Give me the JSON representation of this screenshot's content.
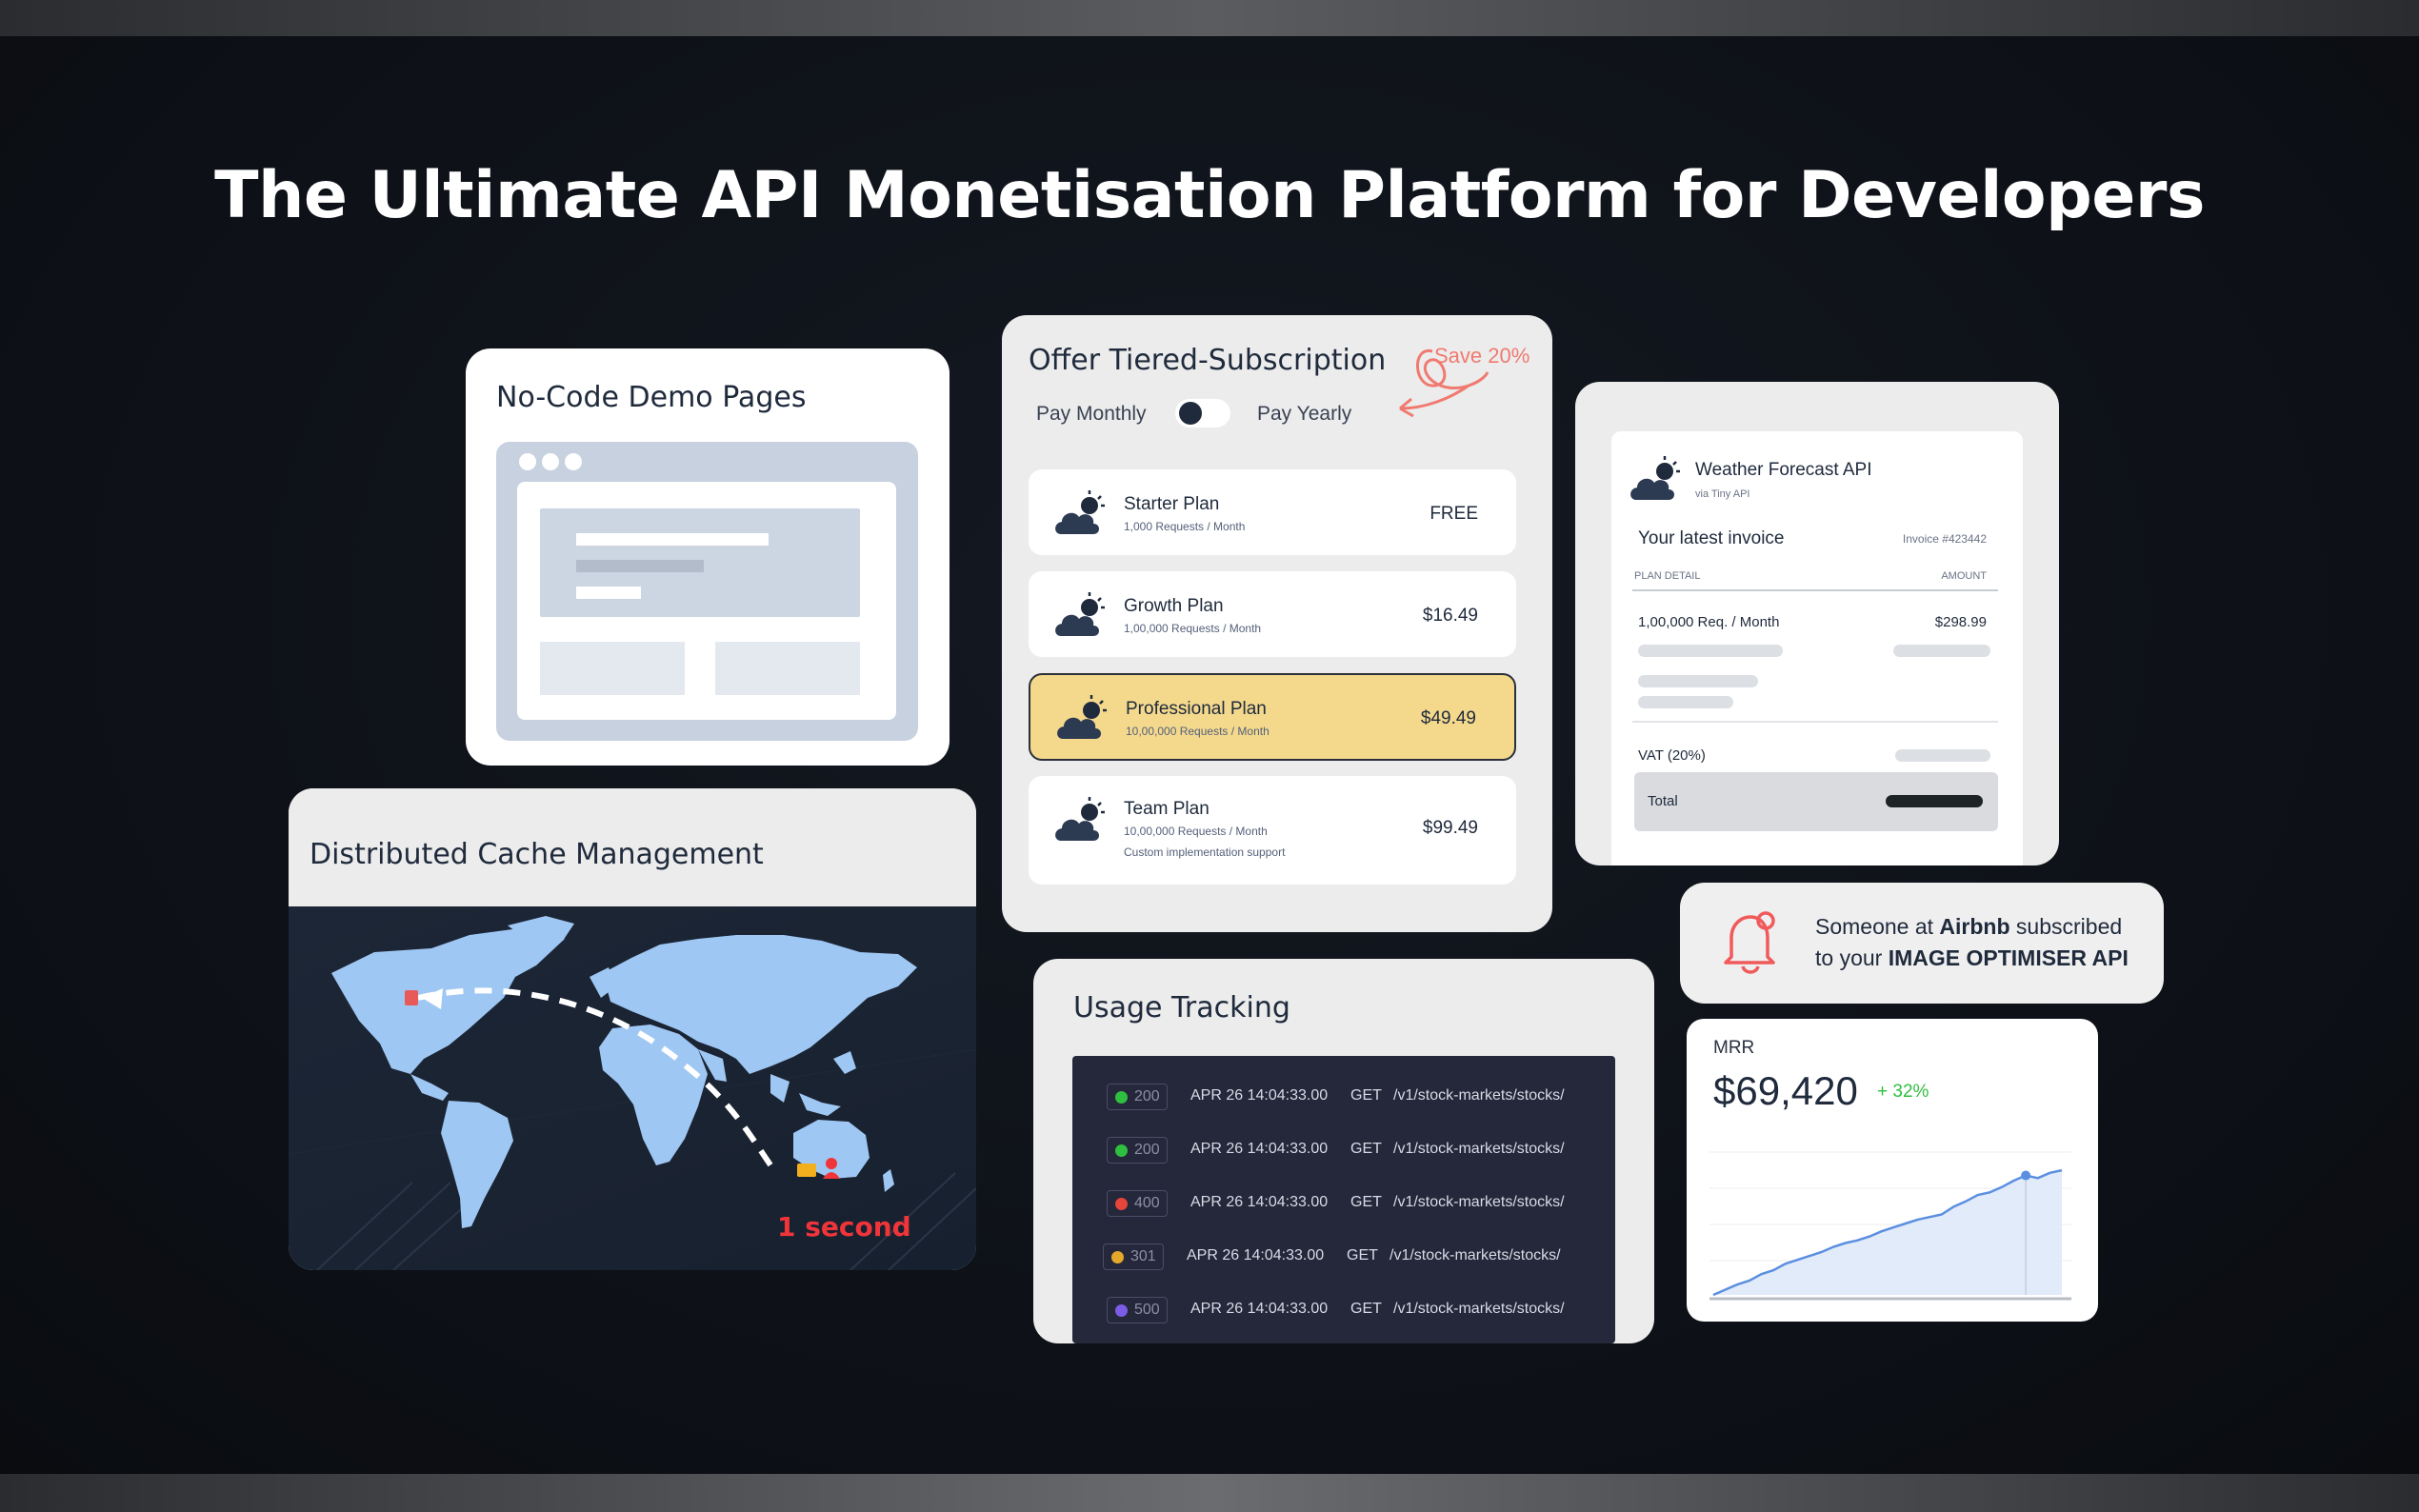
{
  "headline": "The Ultimate API Monetisation Platform for Developers",
  "nocode": {
    "title": "No-Code Demo Pages"
  },
  "cache": {
    "title": "Distributed Cache Management",
    "latency_label": "1 second"
  },
  "subscription": {
    "title": "Offer Tiered-Subscription",
    "pay_monthly": "Pay Monthly",
    "pay_yearly": "Pay Yearly",
    "save_note": "Save 20%",
    "plans": [
      {
        "name": "Starter Plan",
        "detail": "1,000 Requests / Month",
        "extra": "",
        "price": "FREE"
      },
      {
        "name": "Growth Plan",
        "detail": "1,00,000 Requests / Month",
        "extra": "",
        "price": "$16.49"
      },
      {
        "name": "Professional Plan",
        "detail": "10,00,000 Requests / Month",
        "extra": "",
        "price": "$49.49"
      },
      {
        "name": "Team Plan",
        "detail": "10,00,000 Requests / Month",
        "extra": "Custom implementation support",
        "price": "$99.49"
      }
    ]
  },
  "invoice": {
    "api_name": "Weather Forecast API",
    "api_via": "via Tiny API",
    "heading": "Your latest invoice",
    "invoice_no": "Invoice #423442",
    "col_plan": "PLAN DETAIL",
    "col_amount": "AMOUNT",
    "line_item": "1,00,000 Req. / Month",
    "line_amount": "$298.99",
    "vat_label": "VAT (20%)",
    "total_label": "Total"
  },
  "notification": {
    "prefix": "Someone at ",
    "company": "Airbnb",
    "middle": " subscribed",
    "line2_prefix": "to your ",
    "api": "IMAGE OPTIMISER API"
  },
  "mrr": {
    "label": "MRR",
    "value": "$69,420",
    "change": "+ 32%",
    "chart_data": {
      "type": "area",
      "values": [
        0,
        4,
        8,
        11,
        16,
        19,
        24,
        27,
        30,
        33,
        37,
        40,
        42,
        45,
        49,
        52,
        55,
        58,
        60,
        62,
        68,
        72,
        77,
        79,
        83,
        88,
        92,
        90,
        94,
        96
      ],
      "highlight_index": 26,
      "ylim": [
        0,
        110
      ]
    }
  },
  "usage": {
    "title": "Usage Tracking",
    "rows": [
      {
        "code": "200",
        "color": "#2fbf3f",
        "when": "APR 26 14:04:33.00",
        "method": "GET",
        "path": "/v1/stock-markets/stocks/"
      },
      {
        "code": "200",
        "color": "#2fbf3f",
        "when": "APR 26 14:04:33.00",
        "method": "GET",
        "path": "/v1/stock-markets/stocks/"
      },
      {
        "code": "400",
        "color": "#e6453a",
        "when": "APR 26 14:04:33.00",
        "method": "GET",
        "path": "/v1/stock-markets/stocks/"
      },
      {
        "code": "301",
        "color": "#e5a82a",
        "when": "APR 26 14:04:33.00",
        "method": "GET",
        "path": "/v1/stock-markets/stocks/"
      },
      {
        "code": "500",
        "color": "#7a5ce6",
        "when": "APR 26 14:04:33.00",
        "method": "GET",
        "path": "/v1/stock-markets/stocks/"
      }
    ]
  },
  "colors": {
    "background": "#0f1217",
    "card": "#ffffff",
    "highlight_plan": "#f4d98d",
    "accent_red": "#f0353a",
    "save_pink": "#f07a70",
    "chart_line": "#5b8fe0",
    "chart_fill": "#dbe6f8",
    "growth_green": "#2fbf3f"
  }
}
